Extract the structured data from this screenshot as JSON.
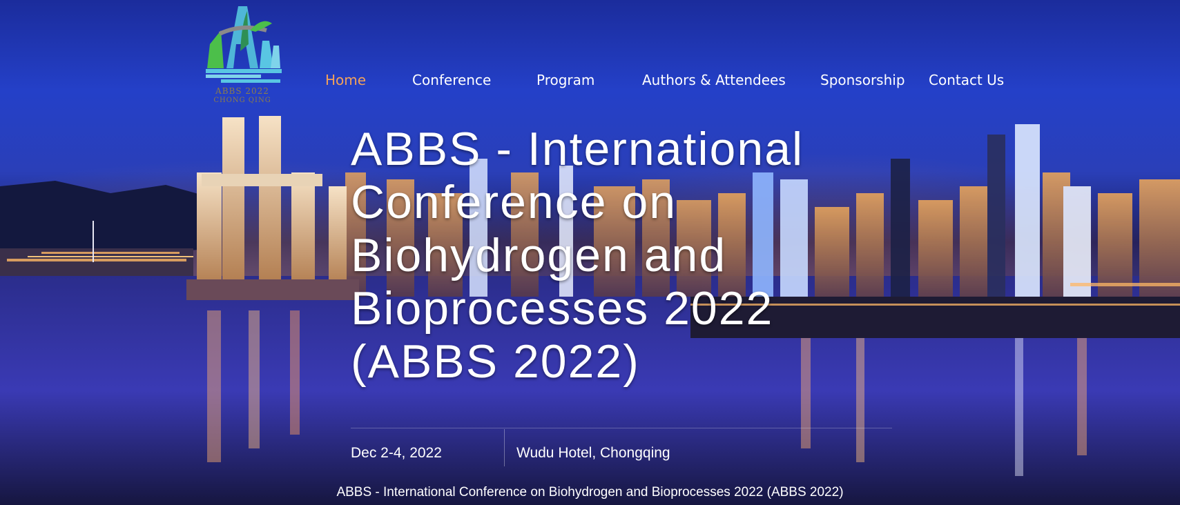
{
  "logo": {
    "line1": "ABBS 2022",
    "line2": "CHONG QING"
  },
  "nav": {
    "items": [
      {
        "label": "Home",
        "active": true
      },
      {
        "label": "Conference",
        "active": false
      },
      {
        "label": "Program",
        "active": false
      },
      {
        "label": "Authors & Attendees",
        "active": false
      },
      {
        "label": "Sponsorship",
        "active": false
      },
      {
        "label": "Contact Us",
        "active": false
      }
    ]
  },
  "hero": {
    "title": "ABBS - International Conference on Biohydrogen and Bioprocesses 2022 (ABBS 2022)",
    "date": "Dec 2-4, 2022",
    "venue": "Wudu Hotel, Chongqing"
  },
  "footer": {
    "caption": "ABBS - International Conference on Biohydrogen and Bioprocesses 2022 (ABBS 2022)"
  },
  "colors": {
    "nav_active": "#f2a25a",
    "nav_default": "#ffffff",
    "sky_top": "#1b2c9c",
    "logo_green": "#4cbf4a",
    "logo_blue": "#4fb6d8"
  }
}
